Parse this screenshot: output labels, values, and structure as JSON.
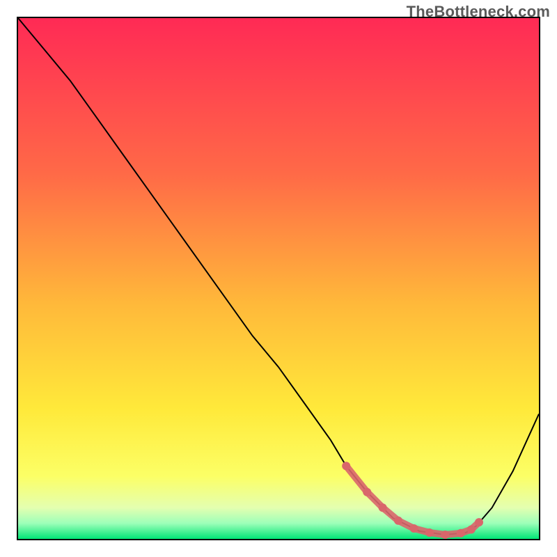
{
  "watermark": "TheBottleneck.com",
  "chart_data": {
    "type": "line",
    "title": "",
    "xlabel": "",
    "ylabel": "",
    "xlim": [
      0,
      100
    ],
    "ylim": [
      0,
      100
    ],
    "grid": false,
    "legend": false,
    "annotations": [],
    "background_gradient": {
      "stops": [
        {
          "offset": 0,
          "color": "#ff2a55"
        },
        {
          "offset": 30,
          "color": "#ff6a47"
        },
        {
          "offset": 55,
          "color": "#ffb93a"
        },
        {
          "offset": 75,
          "color": "#ffe93a"
        },
        {
          "offset": 88,
          "color": "#fcff66"
        },
        {
          "offset": 94,
          "color": "#e4ffb0"
        },
        {
          "offset": 97,
          "color": "#9dffb9"
        },
        {
          "offset": 100,
          "color": "#00e676"
        }
      ]
    },
    "series": [
      {
        "name": "bottleneck-curve",
        "color": "#000000",
        "width": 2,
        "x": [
          0,
          5,
          10,
          15,
          20,
          25,
          30,
          35,
          40,
          45,
          50,
          55,
          60,
          63,
          67,
          72,
          77,
          82,
          86,
          88,
          91,
          95,
          100
        ],
        "values": [
          100,
          94,
          88,
          81,
          74,
          67,
          60,
          53,
          46,
          39,
          33,
          26,
          19,
          14,
          9,
          4,
          1.5,
          0.8,
          1.2,
          2.5,
          6,
          13,
          24
        ]
      },
      {
        "name": "highlight-band",
        "color": "#d9666b",
        "style": "dotted-thick",
        "x": [
          63,
          67,
          70,
          73,
          76,
          79,
          82,
          85,
          87,
          88.5
        ],
        "values": [
          14,
          9,
          6,
          3.5,
          2,
          1.2,
          0.8,
          1.1,
          1.8,
          3.2
        ]
      }
    ]
  }
}
